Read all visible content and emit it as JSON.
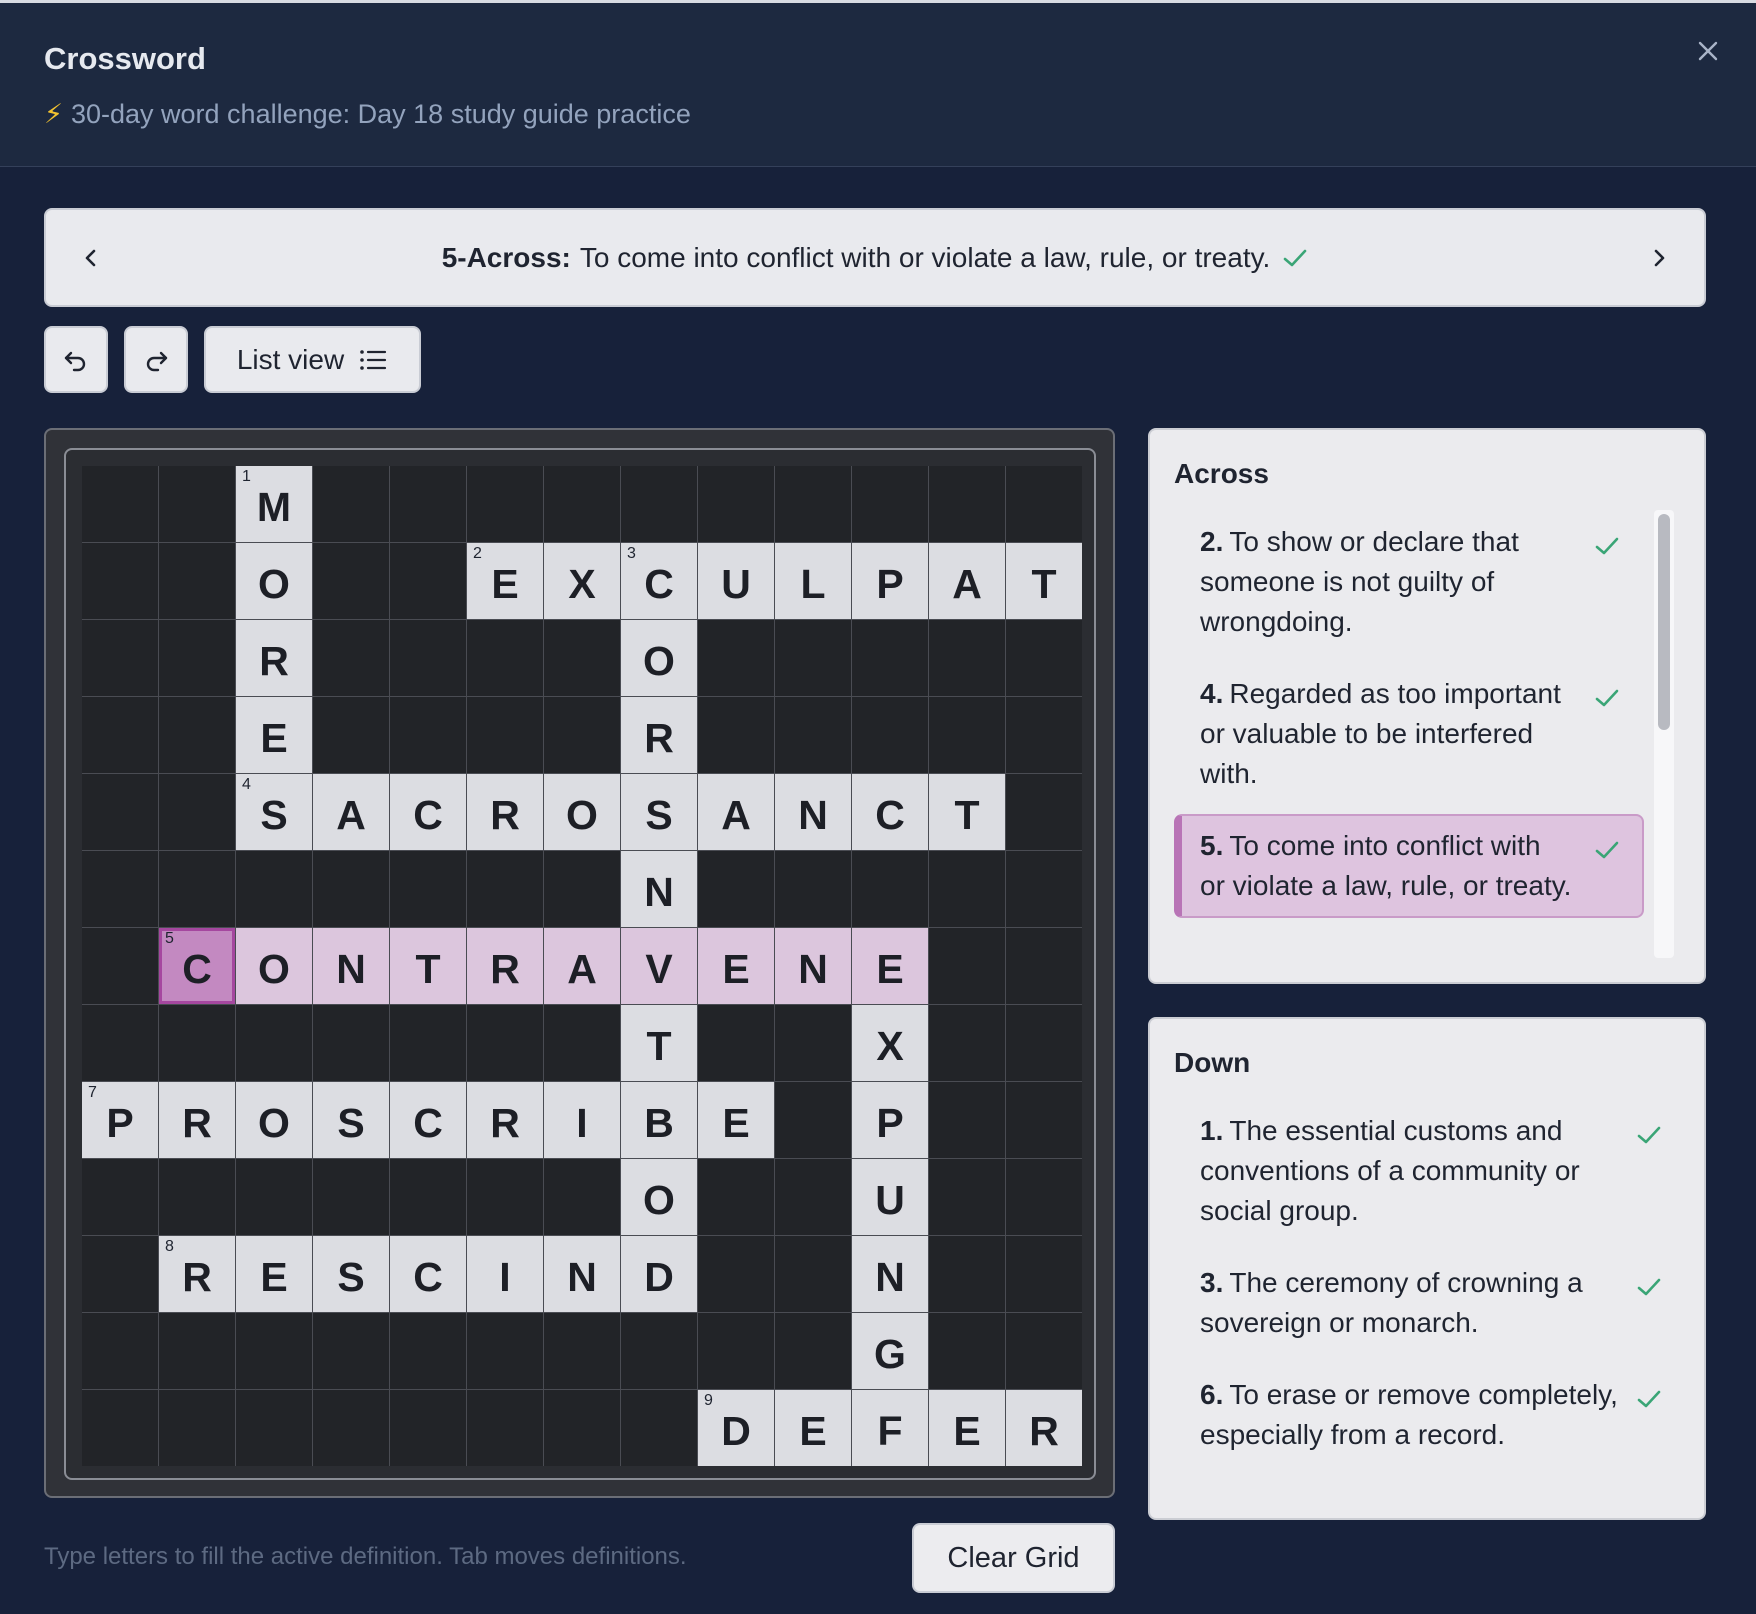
{
  "header": {
    "title": "Crossword",
    "subtitle_icon": "lightning-bolt-icon",
    "subtitle": "30-day word challenge: Day 18 study guide practice"
  },
  "clue_bar": {
    "ref": "5-Across:",
    "text": "To come into conflict with or violate a law, rule, or treaty.",
    "solved": true
  },
  "toolbar": {
    "undo_icon": "undo-icon",
    "redo_icon": "redo-icon",
    "list_view_label": "List view"
  },
  "grid": {
    "size": 13,
    "rows": [
      "..M..........",
      "..O..EXCULPATE",
      "..R....O.....",
      "..E....R.....",
      "..SACROSANCT.",
      ".......N.....",
      ".CONTRAVENE..",
      ".......T..X..",
      "PROSCRIBE.P..",
      ".......O..U..",
      ".RESCIND..N..",
      "..........G..",
      "........DEFER"
    ],
    "numbers": {
      "0,2": "1",
      "1,5": "2",
      "1,7": "3",
      "4,2": "4",
      "6,1": "5",
      "6,11": "6",
      "8,0": "7",
      "10,1": "8",
      "12,8": "9"
    },
    "highlighted_word": "CONTRAVENE",
    "selected_cell": "6,1"
  },
  "across": {
    "title": "Across",
    "clues": [
      {
        "num": "2.",
        "text": "To show or declare that someone is not guilty of wrongdoing.",
        "solved": true,
        "active": false
      },
      {
        "num": "4.",
        "text": "Regarded as too important or valuable to be interfered with.",
        "solved": true,
        "active": false
      },
      {
        "num": "5.",
        "text": "To come into conflict with or violate a law, rule, or treaty.",
        "solved": true,
        "active": true
      }
    ]
  },
  "down": {
    "title": "Down",
    "clues": [
      {
        "num": "1.",
        "text": "The essential customs and conventions of a community or social group.",
        "solved": true
      },
      {
        "num": "3.",
        "text": "The ceremony of crowning a sovereign or monarch.",
        "solved": true
      },
      {
        "num": "6.",
        "text": "To erase or remove completely, especially from a record.",
        "solved": true
      }
    ]
  },
  "footer": {
    "hint": "Type letters to fill the active definition. Tab moves definitions.",
    "clear_label": "Clear Grid"
  },
  "colors": {
    "check": "#3aa576",
    "highlight": "#dcc6dd",
    "selected": "#c389c1"
  }
}
